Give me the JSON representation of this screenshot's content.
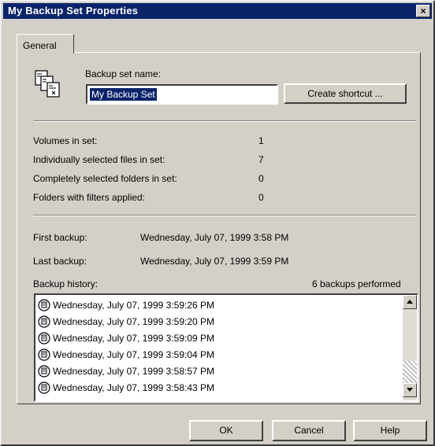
{
  "window": {
    "title": "My Backup Set Properties",
    "close_glyph": "×"
  },
  "tabs": [
    {
      "label": "General",
      "selected": true
    }
  ],
  "backup_set": {
    "name_label": "Backup set name:",
    "name_value": "My Backup Set",
    "create_shortcut_label": "Create shortcut ...",
    "icon": "backup-set-icon"
  },
  "stats": [
    {
      "label": "Volumes in set:",
      "value": "1"
    },
    {
      "label": "Individually selected files in set:",
      "value": "7"
    },
    {
      "label": "Completely selected folders in set:",
      "value": "0"
    },
    {
      "label": "Folders with filters applied:",
      "value": "0"
    }
  ],
  "backups": {
    "first_label": "First backup:",
    "first_value": "Wednesday, July 07, 1999 3:58 PM",
    "last_label": "Last backup:",
    "last_value": "Wednesday, July 07, 1999 3:59 PM"
  },
  "history": {
    "label": "Backup history:",
    "count_text": "6 backups performed",
    "items": [
      "Wednesday, July 07, 1999 3:59:26 PM",
      "Wednesday, July 07, 1999 3:59:20 PM",
      "Wednesday, July 07, 1999 3:59:09 PM",
      "Wednesday, July 07, 1999 3:59:04 PM",
      "Wednesday, July 07, 1999 3:58:57 PM",
      "Wednesday, July 07, 1999 3:58:43 PM"
    ],
    "item_icon": "backup-history-icon"
  },
  "buttons": {
    "ok": "OK",
    "cancel": "Cancel",
    "help": "Help"
  },
  "colors": {
    "titlebar": "#0a246a",
    "face": "#d4d0c8",
    "selection": "#0a246a"
  }
}
